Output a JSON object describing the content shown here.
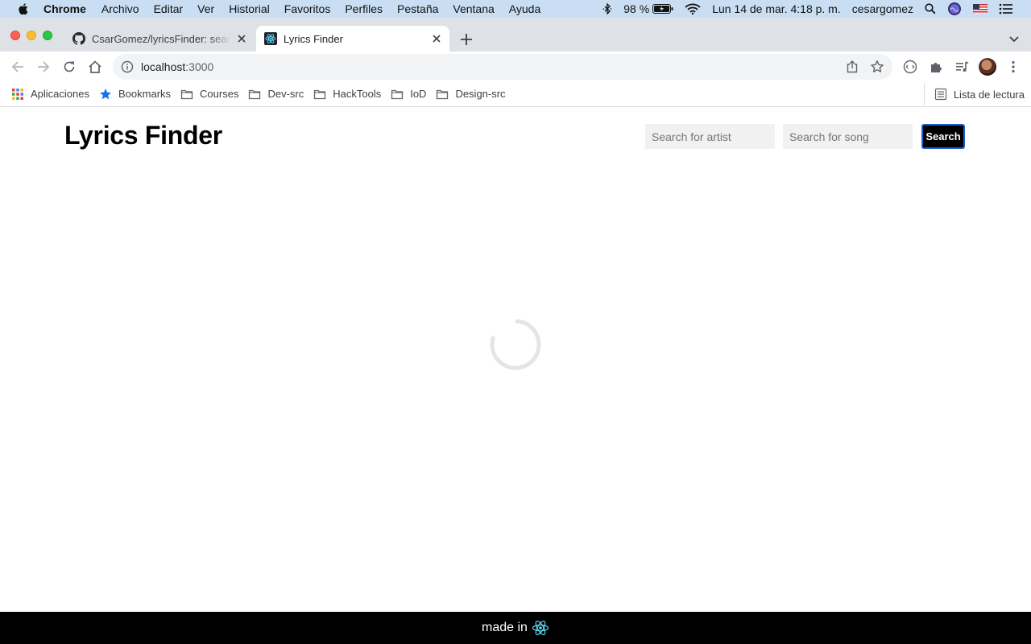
{
  "menubar": {
    "app": "Chrome",
    "items": [
      "Archivo",
      "Editar",
      "Ver",
      "Historial",
      "Favoritos",
      "Perfiles",
      "Pestaña",
      "Ventana",
      "Ayuda"
    ],
    "battery": "98 %",
    "clock": "Lun 14 de mar.  4:18 p. m.",
    "user": "cesargomez"
  },
  "tabs": [
    {
      "title": "CsarGomez/lyricsFinder: search",
      "favicon": "github-icon",
      "active": false
    },
    {
      "title": "Lyrics Finder",
      "favicon": "react-icon",
      "active": true
    }
  ],
  "address_bar": {
    "host": "localhost",
    "port": ":3000"
  },
  "bookmarks": {
    "items": [
      "Aplicaciones",
      "Bookmarks",
      "Courses",
      "Dev-src",
      "HackTools",
      "IoD",
      "Design-src"
    ],
    "reading_list": "Lista de lectura"
  },
  "page": {
    "brand": "Lyrics Finder",
    "artist_placeholder": "Search for artist",
    "song_placeholder": "Search for song",
    "search_button": "Search",
    "loading": true
  },
  "footer": {
    "text": "made in",
    "icon": "react-icon"
  },
  "colors": {
    "menubar_bg": "#c9def2",
    "tabstrip_bg": "#dee1e6",
    "footer_bg": "#000000",
    "button_bg": "#000000",
    "button_border": "#1a5fd0",
    "react": "#61dafb",
    "input_bg": "#f1f1f1"
  }
}
